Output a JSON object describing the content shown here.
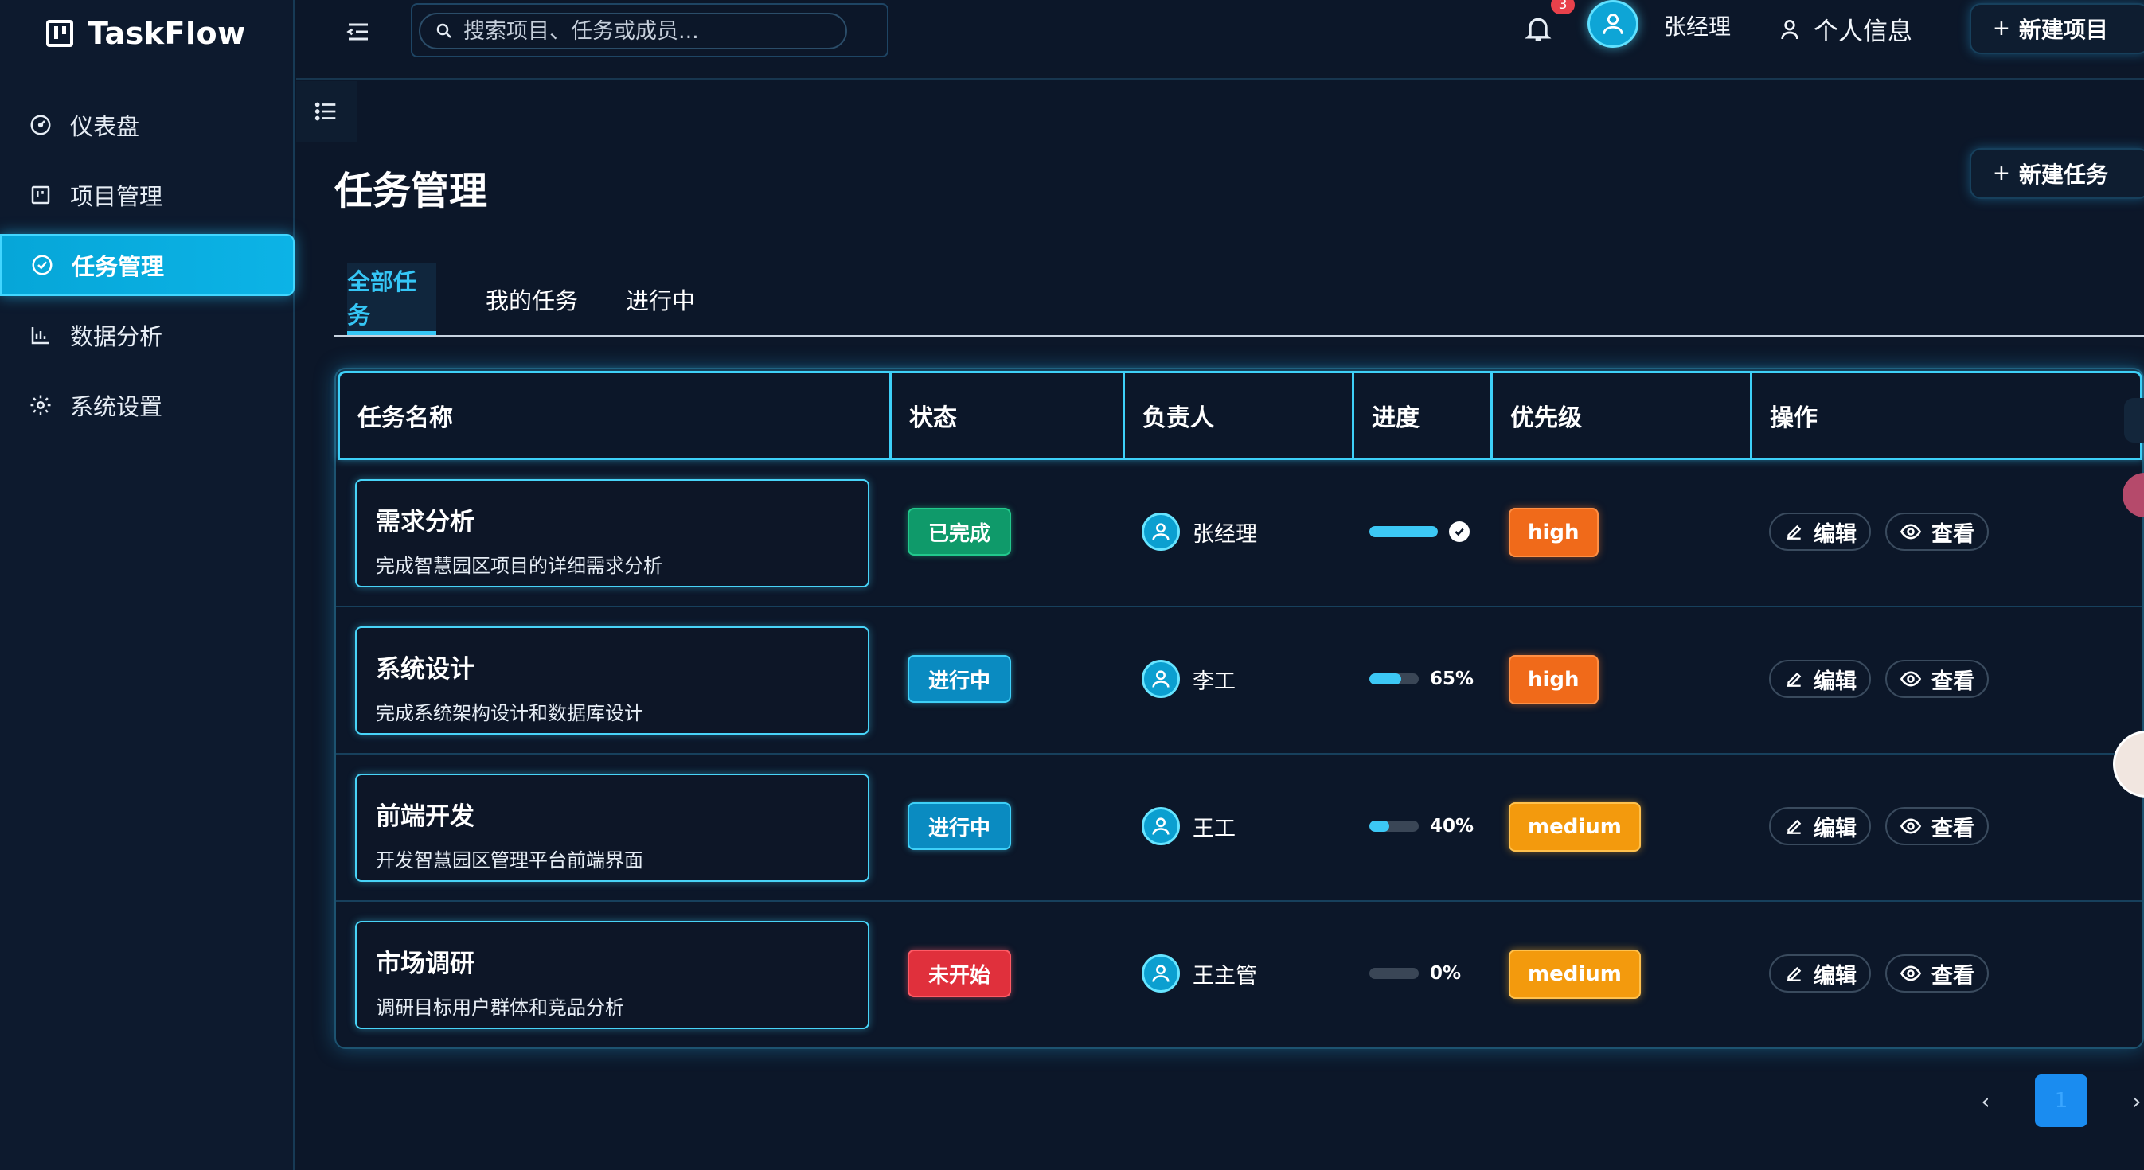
{
  "app": {
    "name": "TaskFlow"
  },
  "sidebar": {
    "items": [
      {
        "label": "仪表盘",
        "icon": "dashboard-icon"
      },
      {
        "label": "项目管理",
        "icon": "kanban-icon"
      },
      {
        "label": "任务管理",
        "icon": "check-circle-icon",
        "active": true
      },
      {
        "label": "数据分析",
        "icon": "bar-chart-icon"
      },
      {
        "label": "系统设置",
        "icon": "gear-icon"
      }
    ]
  },
  "header": {
    "search_placeholder": "搜索项目、任务或成员...",
    "notification_count": "3",
    "user_name": "张经理",
    "profile_label": "个人信息",
    "new_project_label": "新建项目"
  },
  "page": {
    "title": "任务管理",
    "new_task_label": "新建任务",
    "tabs": [
      {
        "label": "全部任务",
        "active": true
      },
      {
        "label": "我的任务"
      },
      {
        "label": "进行中"
      }
    ]
  },
  "table": {
    "columns": [
      "任务名称",
      "状态",
      "负责人",
      "进度",
      "优先级",
      "操作"
    ],
    "edit_label": "编辑",
    "view_label": "查看",
    "rows": [
      {
        "title": "需求分析",
        "desc": "完成智慧园区项目的详细需求分析",
        "status": "已完成",
        "status_type": "done",
        "assignee": "张经理",
        "progress": 100,
        "progress_text": "",
        "priority": "high"
      },
      {
        "title": "系统设计",
        "desc": "完成系统架构设计和数据库设计",
        "status": "进行中",
        "status_type": "progress",
        "assignee": "李工",
        "progress": 65,
        "progress_text": "65%",
        "priority": "high"
      },
      {
        "title": "前端开发",
        "desc": "开发智慧园区管理平台前端界面",
        "status": "进行中",
        "status_type": "progress",
        "assignee": "王工",
        "progress": 40,
        "progress_text": "40%",
        "priority": "medium"
      },
      {
        "title": "市场调研",
        "desc": "调研目标用户群体和竞品分析",
        "status": "未开始",
        "status_type": "todo",
        "assignee": "王主管",
        "progress": 0,
        "progress_text": "0%",
        "priority": "medium"
      }
    ]
  },
  "pagination": {
    "current": "1",
    "prev_icon": "chevron-left-icon",
    "next_icon": "chevron-right-icon"
  },
  "colors": {
    "background": "#0c1729",
    "accent": "#35c6f5",
    "success": "#0f9a6a",
    "danger": "#e0303c",
    "high": "#f06a1a",
    "medium": "#f39a0d"
  }
}
